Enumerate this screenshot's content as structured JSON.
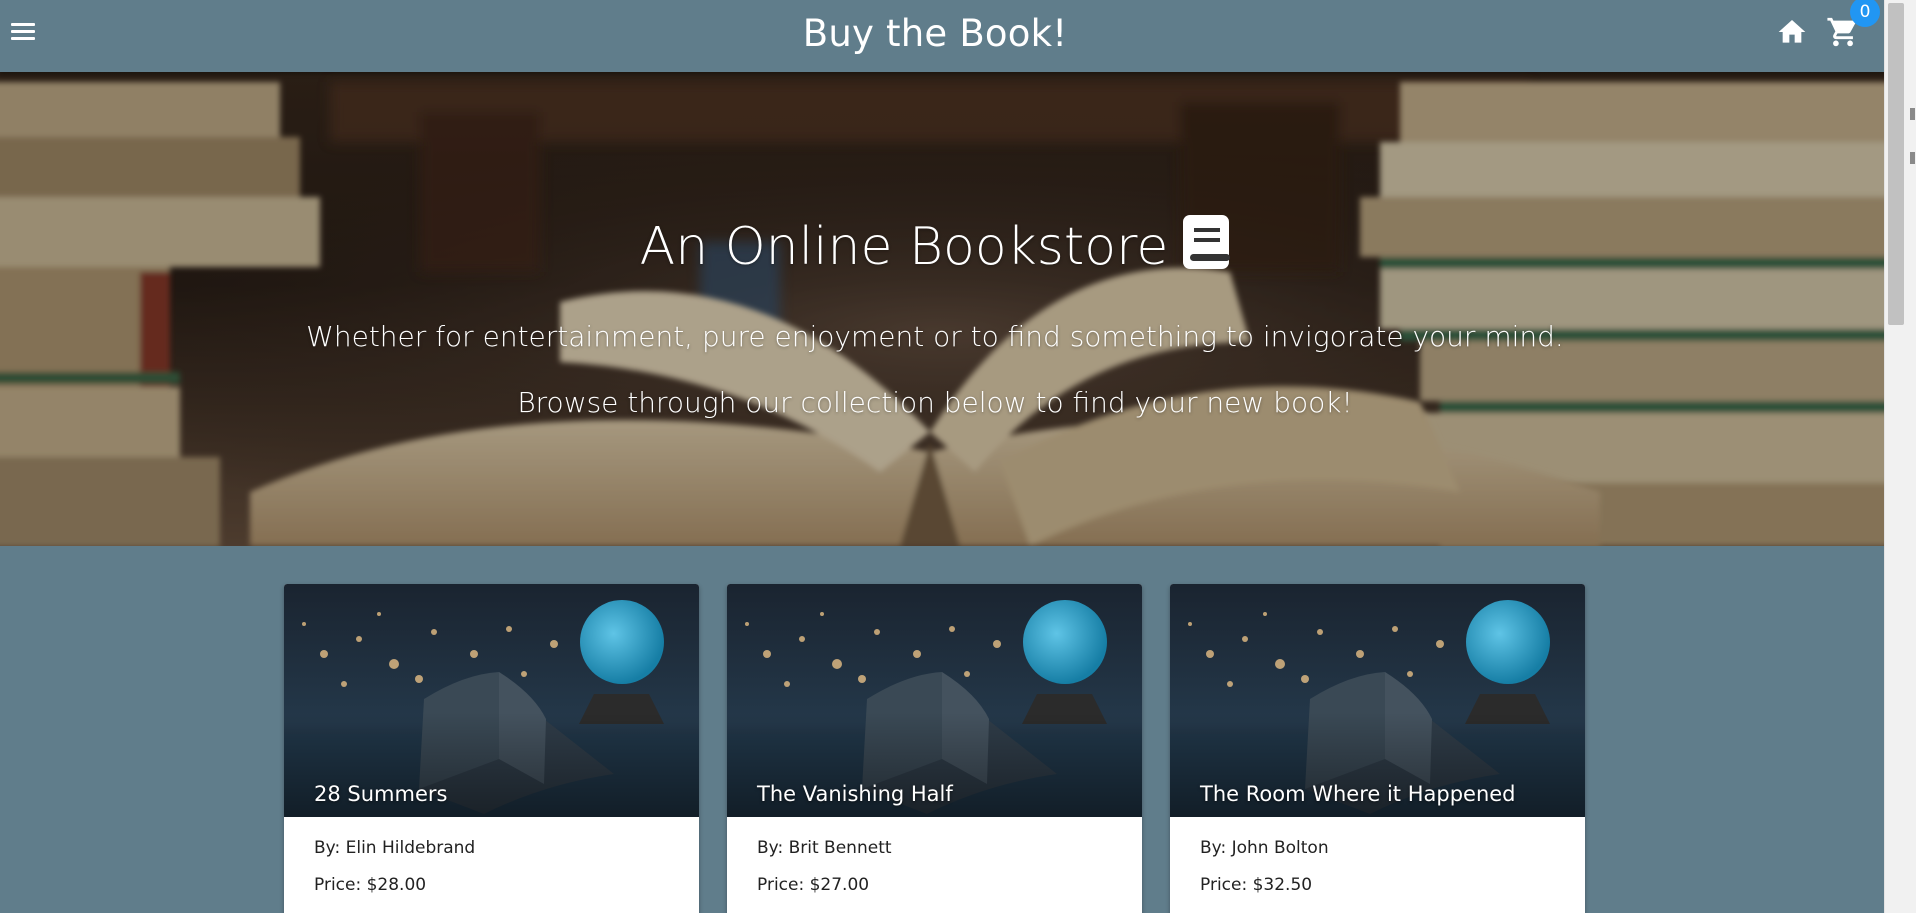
{
  "appbar": {
    "title": "Buy the Book!",
    "menu_icon": "menu-icon",
    "home_icon": "home-icon",
    "cart_icon": "shopping-cart-icon",
    "cart_count": "0",
    "background": "#607d8b",
    "badge_color": "#2196f3"
  },
  "hero": {
    "title": "An Online Bookstore",
    "title_icon": "book-icon",
    "line1": "Whether for entertainment, pure enjoyment or to find something to invigorate your mind.",
    "line2": "Browse through our collection below to find your new book!"
  },
  "books": [
    {
      "title": "28 Summers",
      "author": "By: Elin Hildebrand",
      "price": "Price: $28.00"
    },
    {
      "title": "The Vanishing Half",
      "author": "By: Brit Bennett",
      "price": "Price: $27.00"
    },
    {
      "title": "The Room Where it Happened",
      "author": "By: John Bolton",
      "price": "Price: $32.50"
    }
  ],
  "colors": {
    "page_background": "#607d8b",
    "card_background": "#ffffff",
    "text_on_dark": "#ffffff",
    "text_on_light": "#222222"
  }
}
